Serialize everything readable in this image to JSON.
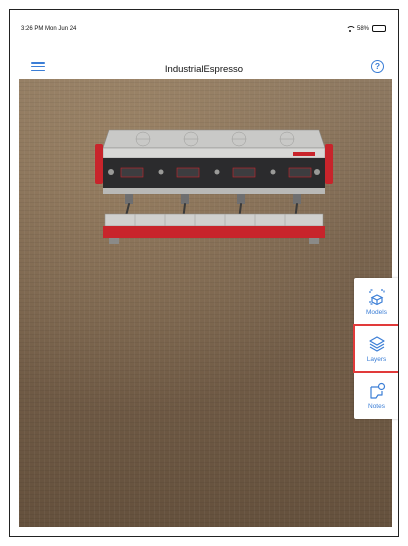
{
  "status_bar": {
    "time": "3:26 PM  Mon Jun 24",
    "battery": "58%"
  },
  "nav": {
    "title": "IndustrialEspresso",
    "help_label": "?"
  },
  "sidebar": {
    "items": [
      {
        "label": "Models",
        "icon": "models-icon"
      },
      {
        "label": "Layers",
        "icon": "layers-icon",
        "highlighted": true
      },
      {
        "label": "Notes",
        "icon": "notes-icon"
      }
    ]
  },
  "colors": {
    "accent": "#3b7ed6",
    "highlight": "#e13a3a",
    "machine_red": "#c8242b"
  }
}
